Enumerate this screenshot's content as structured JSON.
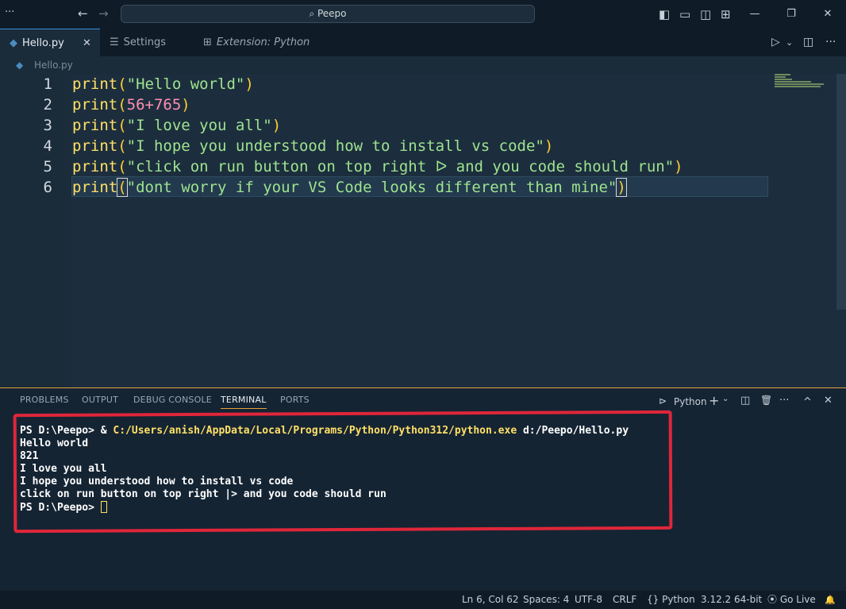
{
  "titlebar": {
    "menu": "···",
    "back": "←",
    "forward": "→",
    "search": "⌕ Peepo",
    "layout_icons": [
      "◧",
      "▭",
      "◫",
      "⊞"
    ],
    "minimize": "—",
    "restore": "❐",
    "close": "✕"
  },
  "tabs": [
    {
      "label": "Hello.py",
      "icon": "python-icon",
      "close": "✕"
    },
    {
      "label": "Settings",
      "icon": "settings-icon"
    },
    {
      "label": "Extension: Python",
      "icon": "extension-icon"
    }
  ],
  "tab_actions": {
    "run": "▷",
    "run_menu": "⌄",
    "split": "◫",
    "more": "···"
  },
  "breadcrumb": "Hello.py",
  "editor": {
    "lines": [
      {
        "n": "1",
        "parts": [
          [
            "kw",
            "print"
          ],
          [
            "brk",
            "("
          ],
          [
            "str",
            "\"Hello world\""
          ],
          [
            "brk",
            ")"
          ]
        ]
      },
      {
        "n": "2",
        "parts": [
          [
            "kw",
            "print"
          ],
          [
            "brk",
            "("
          ],
          [
            "num",
            "56+765"
          ],
          [
            "brk",
            ")"
          ]
        ]
      },
      {
        "n": "3",
        "parts": [
          [
            "kw",
            "print"
          ],
          [
            "brk",
            "("
          ],
          [
            "str",
            "\"I love you all\""
          ],
          [
            "brk",
            ")"
          ]
        ]
      },
      {
        "n": "4",
        "parts": [
          [
            "kw",
            "print"
          ],
          [
            "brk",
            "("
          ],
          [
            "str",
            "\"I hope you understood how to install vs code\""
          ],
          [
            "brk",
            ")"
          ]
        ]
      },
      {
        "n": "5",
        "parts": [
          [
            "kw",
            "print"
          ],
          [
            "brk",
            "("
          ],
          [
            "str",
            "\"click on run button on top right ᐅ and you code should run\""
          ],
          [
            "brk",
            ")"
          ]
        ]
      },
      {
        "n": "6",
        "parts": [
          [
            "kw",
            "print"
          ],
          [
            "brk",
            "("
          ],
          [
            "str",
            "\"dont worry if your VS Code looks different than mine\""
          ],
          [
            "brk",
            ")"
          ]
        ]
      }
    ]
  },
  "panel": {
    "tabs": [
      "PROBLEMS",
      "OUTPUT",
      "DEBUG CONSOLE",
      "TERMINAL",
      "PORTS"
    ],
    "active_tab": "TERMINAL",
    "terminal_name": "Python",
    "actions": {
      "add": "+",
      "add_menu": "⌄",
      "split": "◫",
      "trash": "🗑",
      "more": "···",
      "maximize": "^",
      "close": "✕"
    },
    "terminal": {
      "cmd_prompt": "PS D:\\Peepo> & ",
      "cmd_exe": "C:/Users/anish/AppData/Local/Programs/Python/Python312/python.exe",
      "cmd_arg": " d:/Peepo/Hello.py",
      "output": [
        "Hello world",
        "821",
        "I love you all",
        "I hope you understood how to install vs code",
        "click on run button on top right |> and you code should run"
      ],
      "final_prompt": "PS D:\\Peepo> "
    }
  },
  "statusbar": {
    "position": "Ln 6, Col 62",
    "spaces": "Spaces: 4",
    "encoding": "UTF-8",
    "eol": "CRLF",
    "language": "{} Python",
    "interpreter": "3.12.2 64-bit",
    "golive": "⦿ Go Live",
    "bell": "🔔"
  },
  "colors": {
    "accent": "#e8a13a",
    "highlight_box": "#e0263a",
    "keyword": "#ffe066",
    "string": "#9fe38f",
    "number": "#ff8fb0"
  }
}
